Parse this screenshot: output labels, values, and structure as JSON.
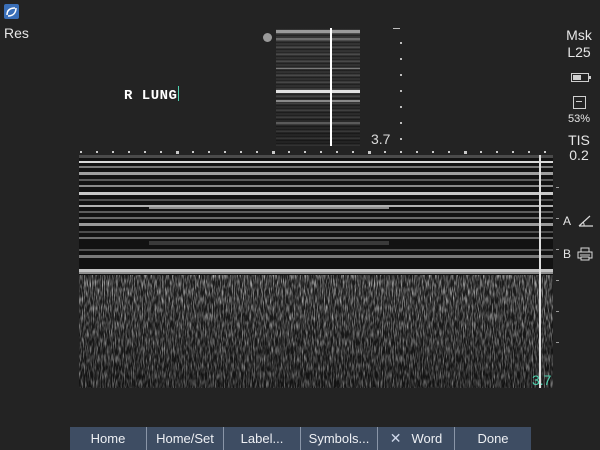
{
  "header": {
    "mode_label": "Res"
  },
  "annotation": {
    "text": "R LUNG"
  },
  "thumbnail": {
    "depth": "3.7"
  },
  "right_panel": {
    "preset": "Msk",
    "transducer": "L25",
    "storage_percent": "53%",
    "tis_label": "TIS",
    "tis_value": "0.2",
    "marker_a": "A",
    "marker_b": "B"
  },
  "mmode": {
    "depth": "3.7"
  },
  "softkeys": [
    {
      "label": "Home"
    },
    {
      "label": "Home/Set"
    },
    {
      "label": "Label..."
    },
    {
      "label": "Symbols..."
    },
    {
      "label": "Word",
      "icon": "x-icon"
    },
    {
      "label": "Done"
    }
  ],
  "icons": [
    "logo-icon",
    "dot-icon",
    "battery-icon",
    "disk-icon",
    "ruler-icon",
    "printer-icon"
  ],
  "colors": {
    "accent": "#4fd3b0",
    "softkey_bar": "#3e4d63",
    "background": "#232323"
  }
}
